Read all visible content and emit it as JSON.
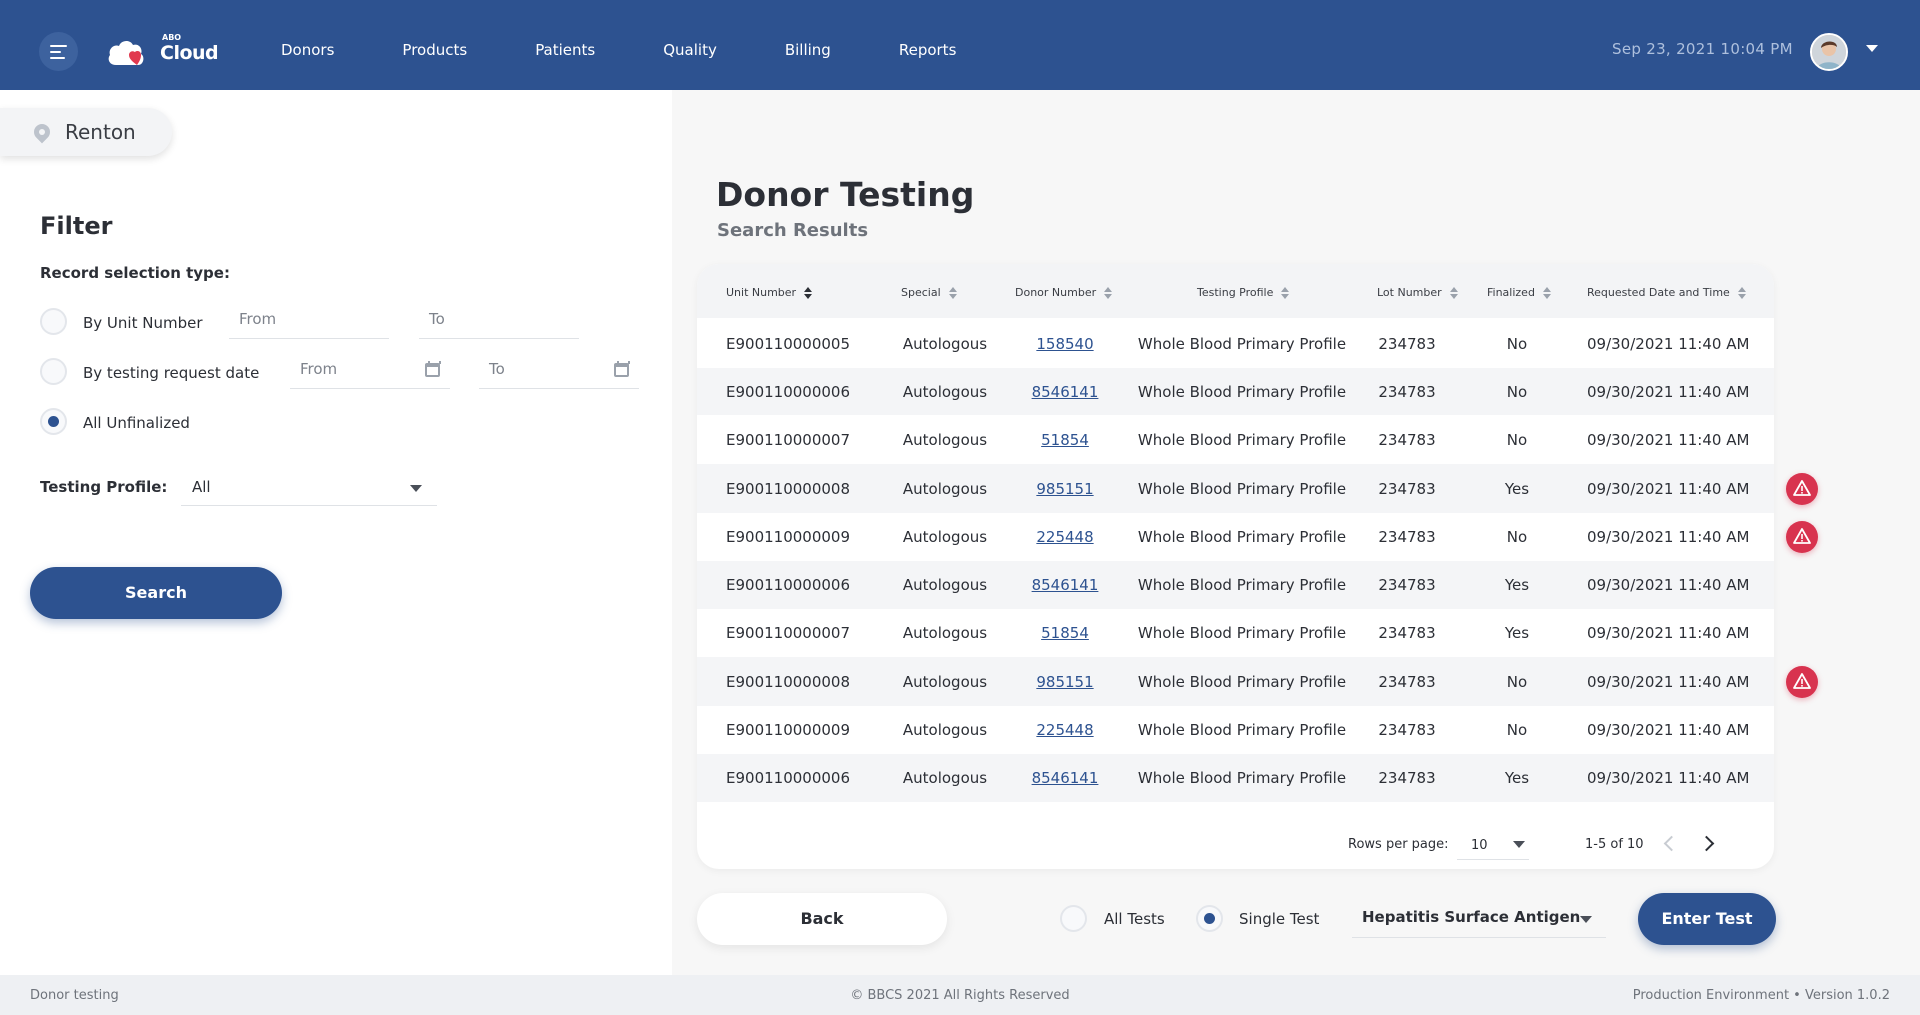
{
  "header": {
    "logo_small": "ABO",
    "logo_text": "Cloud",
    "nav": [
      "Donors",
      "Products",
      "Patients",
      "Quality",
      "Billing",
      "Reports"
    ],
    "datetime": "Sep 23, 2021 10:04 PM"
  },
  "location": "Renton",
  "filter": {
    "title": "Filter",
    "record_type_label": "Record selection type:",
    "by_unit": "By Unit Number",
    "by_date": "By testing request date",
    "all_unfinalized": "All Unfinalized",
    "from": "From",
    "to": "To",
    "selected": "all_unfinalized",
    "profile_label": "Testing Profile:",
    "profile_value": "All",
    "search_button": "Search"
  },
  "main": {
    "title": "Donor Testing",
    "subtitle": "Search Results"
  },
  "table": {
    "columns": [
      "Unit Number",
      "Special",
      "Donor Number",
      "Testing Profile",
      "Lot Number",
      "Finalized",
      "Requested Date and Time"
    ],
    "rows": [
      {
        "unit": "E900110000005",
        "special": "Autologous",
        "donor": "158540",
        "profile": "Whole Blood Primary Profile",
        "lot": "234783",
        "finalized": "No",
        "date": "09/30/2021",
        "time": "11:40 AM",
        "alert": false
      },
      {
        "unit": "E900110000006",
        "special": "Autologous",
        "donor": "8546141",
        "profile": "Whole Blood Primary Profile",
        "lot": "234783",
        "finalized": "No",
        "date": "09/30/2021",
        "time": "11:40 AM",
        "alert": false
      },
      {
        "unit": "E900110000007",
        "special": "Autologous",
        "donor": "51854",
        "profile": "Whole Blood Primary Profile",
        "lot": "234783",
        "finalized": "No",
        "date": "09/30/2021",
        "time": "11:40 AM",
        "alert": false
      },
      {
        "unit": "E900110000008",
        "special": "Autologous",
        "donor": "985151",
        "profile": "Whole Blood Primary Profile",
        "lot": "234783",
        "finalized": "Yes",
        "date": "09/30/2021",
        "time": "11:40 AM",
        "alert": true
      },
      {
        "unit": "E900110000009",
        "special": "Autologous",
        "donor": "225448",
        "profile": "Whole Blood Primary Profile",
        "lot": "234783",
        "finalized": "No",
        "date": "09/30/2021",
        "time": "11:40 AM",
        "alert": true
      },
      {
        "unit": "E900110000006",
        "special": "Autologous",
        "donor": "8546141",
        "profile": "Whole Blood Primary Profile",
        "lot": "234783",
        "finalized": "Yes",
        "date": "09/30/2021",
        "time": "11:40 AM",
        "alert": false
      },
      {
        "unit": "E900110000007",
        "special": "Autologous",
        "donor": "51854",
        "profile": "Whole Blood Primary Profile",
        "lot": "234783",
        "finalized": "Yes",
        "date": "09/30/2021",
        "time": "11:40 AM",
        "alert": false
      },
      {
        "unit": "E900110000008",
        "special": "Autologous",
        "donor": "985151",
        "profile": "Whole Blood Primary Profile",
        "lot": "234783",
        "finalized": "No",
        "date": "09/30/2021",
        "time": "11:40 AM",
        "alert": true
      },
      {
        "unit": "E900110000009",
        "special": "Autologous",
        "donor": "225448",
        "profile": "Whole Blood Primary Profile",
        "lot": "234783",
        "finalized": "No",
        "date": "09/30/2021",
        "time": "11:40 AM",
        "alert": false
      },
      {
        "unit": "E900110000006",
        "special": "Autologous",
        "donor": "8546141",
        "profile": "Whole Blood Primary Profile",
        "lot": "234783",
        "finalized": "Yes",
        "date": "09/30/2021",
        "time": "11:40 AM",
        "alert": false
      }
    ]
  },
  "pager": {
    "rows_label": "Rows per page:",
    "rows_value": "10",
    "range": "1-5 of 10"
  },
  "actions": {
    "back": "Back",
    "all_tests": "All Tests",
    "single_test": "Single Test",
    "selected_mode": "single_test",
    "test_value": "Hepatitis Surface Antigen",
    "enter_test": "Enter Test"
  },
  "footer": {
    "left": "Donor testing",
    "center": "© BBCS 2021 All Rights Reserved",
    "right": "Production Environment  •  Version 1.0.2"
  },
  "colors": {
    "primary": "#2d5290",
    "alert": "#d8334f"
  }
}
